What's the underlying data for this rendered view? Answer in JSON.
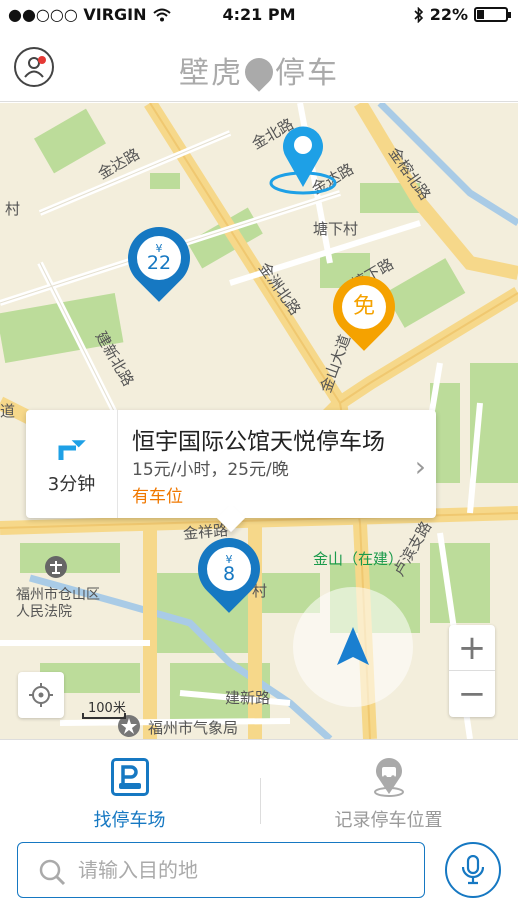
{
  "status_bar": {
    "carrier": "●●○○○ VIRGIN",
    "time": "4:21 PM",
    "battery": "22%",
    "battery_level": 0.22
  },
  "header": {
    "logo_left": "壁虎",
    "logo_right": "停车",
    "icons": {
      "profile": "user-icon",
      "logo_mark": "gecko-pin-icon"
    }
  },
  "map": {
    "labels": {
      "jinda": "金达路",
      "jinbei": "金北路",
      "tangxiacun": "塘下村",
      "jinzhoubei": "金洲北路",
      "jianxinbei": "建新北路",
      "jinrongbei": "金榕北路",
      "tangxia_road": "塘下路",
      "jinshan_ave": "金山大道",
      "jinxiang": "金祥路",
      "jinshan_station": "金山（在建）",
      "court": "福州市仓山区人民法院",
      "jianxin": "建新路",
      "weather": "福州市气象局",
      "cun": "村",
      "dao": "道",
      "luxi": "卢滨支路"
    },
    "pins": [
      {
        "id": "pin-22",
        "price_symbol": "¥",
        "value": "22",
        "color": "#1678c2"
      },
      {
        "id": "pin-free",
        "value": "免",
        "color": "#f5a200"
      },
      {
        "id": "pin-8",
        "price_symbol": "¥",
        "value": "8",
        "color": "#1678c2"
      }
    ],
    "info_card": {
      "time": "3分钟",
      "title": "恒宇国际公馆天悦停车场",
      "price": "15元/小时，25元/晚",
      "status": "有车位"
    },
    "zoom_in": "+",
    "zoom_out": "−",
    "scale": "100米"
  },
  "bottom": {
    "tabs": [
      {
        "label": "找停车场",
        "icon": "parking-icon",
        "active": true
      },
      {
        "label": "记录停车位置",
        "icon": "record-location-icon",
        "active": false
      }
    ],
    "search_placeholder": "请输入目的地",
    "search_value": ""
  },
  "colors": {
    "accent": "#1678c2",
    "free": "#f5a200",
    "status_available": "#f07800",
    "road": "#f6d88a",
    "green": "#bcdc9a",
    "water": "#a9cbe6"
  }
}
